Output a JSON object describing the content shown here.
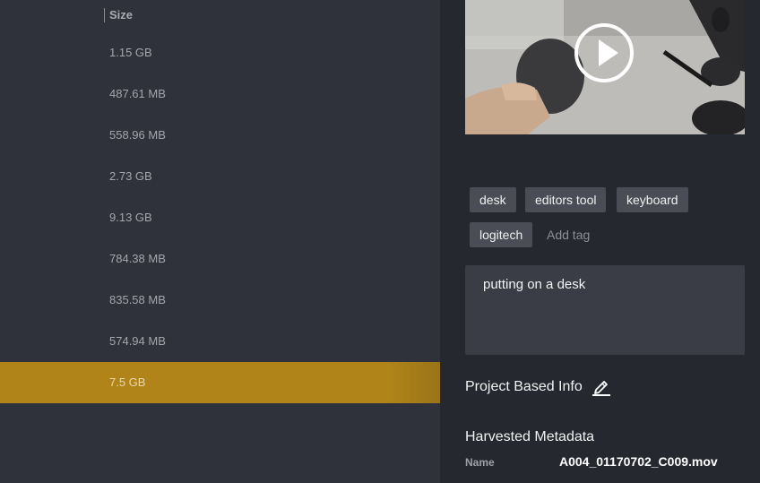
{
  "file_list": {
    "size_header": "Size",
    "rows": [
      {
        "size": "1.15 GB",
        "selected": false
      },
      {
        "size": "487.61 MB",
        "selected": false
      },
      {
        "size": "558.96 MB",
        "selected": false
      },
      {
        "size": "2.73 GB",
        "selected": false
      },
      {
        "size": "9.13 GB",
        "selected": false
      },
      {
        "size": "784.38 MB",
        "selected": false
      },
      {
        "size": "835.58 MB",
        "selected": false
      },
      {
        "size": "574.94 MB",
        "selected": false
      },
      {
        "size": "7.5 GB",
        "selected": true
      }
    ]
  },
  "details": {
    "tags": [
      "desk",
      "editors tool",
      "keyboard",
      "logitech"
    ],
    "add_tag_label": "Add tag",
    "description": "putting on a desk",
    "project_info_title": "Project Based Info",
    "metadata_title": "Harvested Metadata",
    "metadata": [
      {
        "label": "Name",
        "value": "A004_01170702_C009.mov"
      }
    ]
  },
  "colors": {
    "selected_row": "#b08419",
    "panel_bg": "#25282e",
    "list_bg": "#2f323a"
  }
}
